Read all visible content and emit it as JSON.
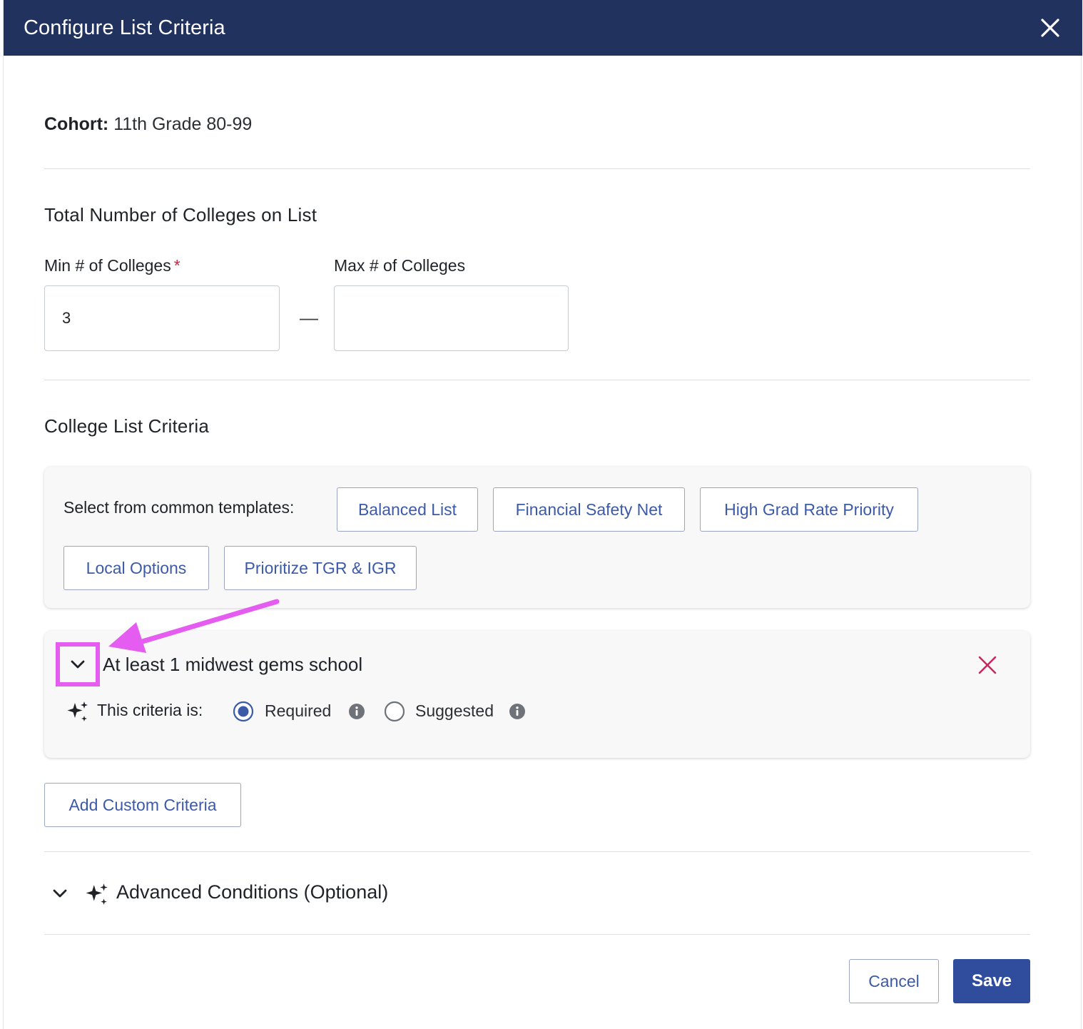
{
  "modal": {
    "title": "Configure List Criteria",
    "close_icon": "close-icon"
  },
  "cohort": {
    "label": "Cohort:",
    "value": "11th Grade 80-99"
  },
  "total_section": {
    "heading": "Total Number of Colleges on List",
    "min_label": "Min # of Colleges",
    "min_required_marker": "*",
    "min_value": "3",
    "range_separator": "—",
    "max_label": "Max # of Colleges",
    "max_value": ""
  },
  "criteria_section": {
    "heading": "College List Criteria",
    "templates_label": "Select from common templates:",
    "templates": [
      "Balanced List",
      "Financial Safety Net",
      "High Grad Rate Priority",
      "Local Options",
      "Prioritize TGR & IGR"
    ]
  },
  "criteria_card": {
    "title": "At least 1 midwest gems school",
    "type_label": "This criteria is:",
    "options": [
      {
        "label": "Required",
        "selected": true
      },
      {
        "label": "Suggested",
        "selected": false
      }
    ],
    "expand_icon": "chevron-down-icon",
    "delete_icon": "close-icon",
    "sparkle_icon": "sparkle-icon",
    "info_icon": "info-icon"
  },
  "add_custom_label": "Add Custom Criteria",
  "advanced": {
    "title": "Advanced Conditions (Optional)"
  },
  "footer": {
    "cancel_label": "Cancel",
    "save_label": "Save"
  },
  "colors": {
    "header_bg": "#22325f",
    "accent": "#3c5aa8",
    "primary_button": "#2f4d9c",
    "delete_icon": "#c8285e",
    "annotation": "#e55cf0"
  }
}
